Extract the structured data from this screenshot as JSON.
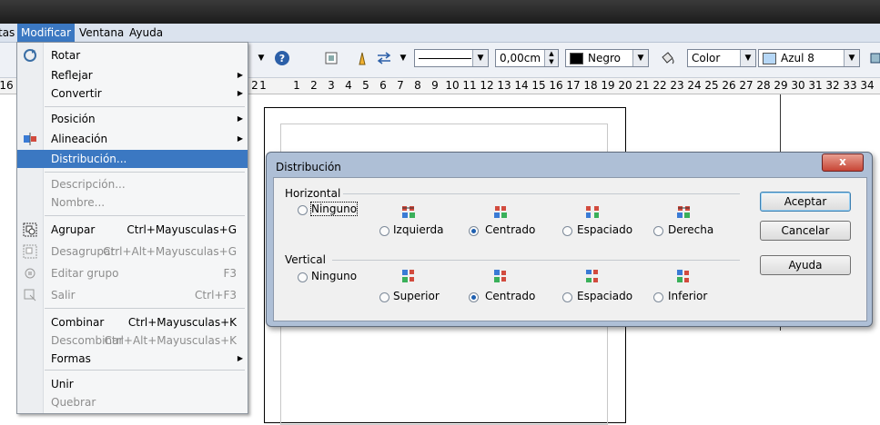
{
  "menubar": {
    "items": [
      {
        "label": "tas"
      },
      {
        "label": "Modificar"
      },
      {
        "label": "Ventana"
      },
      {
        "label": "Ayuda"
      }
    ]
  },
  "toolbar": {
    "line_width": "0,00cm",
    "line_color": "Negro",
    "line_color_hex": "#000000",
    "area_type": "Color",
    "area_color": "Azul 8",
    "area_color_hex": "#b6d7f6"
  },
  "ruler": {
    "ticks": [
      "16",
      "2",
      "1",
      "1",
      "2",
      "3",
      "4",
      "5",
      "6",
      "7",
      "8",
      "9",
      "10",
      "11",
      "12",
      "13",
      "14",
      "15",
      "16",
      "17",
      "18",
      "19",
      "20",
      "21",
      "22",
      "23",
      "24",
      "25",
      "26",
      "27",
      "28",
      "29",
      "30",
      "31",
      "32",
      "33",
      "34"
    ]
  },
  "menu": {
    "items": [
      {
        "label": "Rotar",
        "shortcut": "",
        "submenu": false,
        "disabled": false,
        "highlighted": false,
        "icon": "rotate-icon"
      },
      {
        "label": "Reflejar",
        "shortcut": "",
        "submenu": true,
        "disabled": false,
        "highlighted": false,
        "icon": ""
      },
      {
        "label": "Convertir",
        "shortcut": "",
        "submenu": true,
        "disabled": false,
        "highlighted": false,
        "icon": ""
      },
      {
        "label": "Posición",
        "shortcut": "",
        "submenu": true,
        "disabled": false,
        "highlighted": false,
        "icon": ""
      },
      {
        "label": "Alineación",
        "shortcut": "",
        "submenu": true,
        "disabled": false,
        "highlighted": false,
        "icon": "align-icon"
      },
      {
        "label": "Distribución...",
        "shortcut": "",
        "submenu": false,
        "disabled": false,
        "highlighted": true,
        "icon": ""
      },
      {
        "label": "Descripción...",
        "shortcut": "",
        "submenu": false,
        "disabled": true,
        "highlighted": false,
        "icon": ""
      },
      {
        "label": "Nombre...",
        "shortcut": "",
        "submenu": false,
        "disabled": true,
        "highlighted": false,
        "icon": ""
      },
      {
        "label": "Agrupar",
        "shortcut": "Ctrl+Mayusculas+G",
        "submenu": false,
        "disabled": false,
        "highlighted": false,
        "icon": "group-icon"
      },
      {
        "label": "Desagrupar",
        "shortcut": "Ctrl+Alt+Mayusculas+G",
        "submenu": false,
        "disabled": true,
        "highlighted": false,
        "icon": "ungroup-icon"
      },
      {
        "label": "Editar grupo",
        "shortcut": "F3",
        "submenu": false,
        "disabled": true,
        "highlighted": false,
        "icon": "edit-group-icon"
      },
      {
        "label": "Salir",
        "shortcut": "Ctrl+F3",
        "submenu": false,
        "disabled": true,
        "highlighted": false,
        "icon": "exit-group-icon"
      },
      {
        "label": "Combinar",
        "shortcut": "Ctrl+Mayusculas+K",
        "submenu": false,
        "disabled": false,
        "highlighted": false,
        "icon": ""
      },
      {
        "label": "Descombinar",
        "shortcut": "Ctrl+Alt+Mayusculas+K",
        "submenu": false,
        "disabled": true,
        "highlighted": false,
        "icon": ""
      },
      {
        "label": "Formas",
        "shortcut": "",
        "submenu": true,
        "disabled": false,
        "highlighted": false,
        "icon": ""
      },
      {
        "label": "Unir",
        "shortcut": "",
        "submenu": false,
        "disabled": false,
        "highlighted": false,
        "icon": ""
      },
      {
        "label": "Quebrar",
        "shortcut": "",
        "submenu": false,
        "disabled": true,
        "highlighted": false,
        "icon": ""
      }
    ]
  },
  "dialog": {
    "title": "Distribución",
    "close_label": "x",
    "horizontal": {
      "label": "Horizontal",
      "options": [
        "Ninguno",
        "Izquierda",
        "Centrado",
        "Espaciado",
        "Derecha"
      ],
      "selected": "Centrado"
    },
    "vertical": {
      "label": "Vertical",
      "options": [
        "Ninguno",
        "Superior",
        "Centrado",
        "Espaciado",
        "Inferior"
      ],
      "selected": "Centrado"
    },
    "buttons": {
      "ok": "Aceptar",
      "cancel": "Cancelar",
      "help": "Ayuda"
    }
  }
}
